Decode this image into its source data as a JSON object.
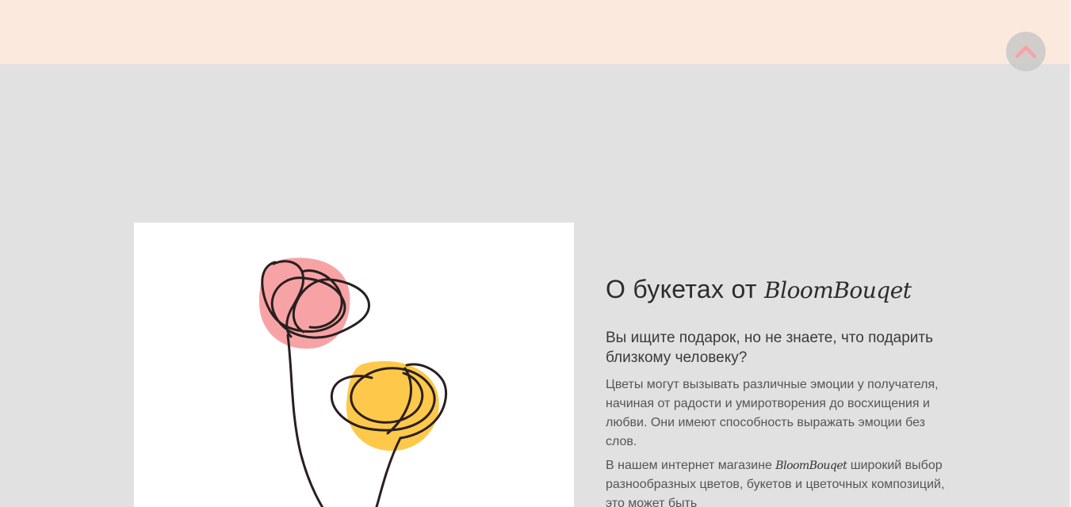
{
  "header": {
    "background_color": "#fbe9de"
  },
  "scroll_top_button": {
    "icon": "chevron-up-icon",
    "icon_color": "#f7a3a6"
  },
  "about": {
    "title_prefix": "О букетах от",
    "brand": "BloomBouqet",
    "lead": "Вы ищите подарок, но не знаете, что подарить близкому человеку?",
    "paragraph1": "Цветы могут вызывать различные эмоции у получателя, начиная от радости и умиротворения до восхищения и любви. Они имеют способность выражать эмоции без слов.",
    "paragraph2_before": "В нашем интернет магазине",
    "paragraph2_brand": "BloomBouqet",
    "paragraph2_after": "широкий выбор разнообразных цветов, букетов и цветочных композиций, это может быть"
  },
  "illustration": {
    "subject": "line-art-flowers",
    "colors": {
      "pink_blob": "#f7a3a6",
      "yellow_blob": "#fec94a",
      "line": "#2a1f1f"
    }
  }
}
